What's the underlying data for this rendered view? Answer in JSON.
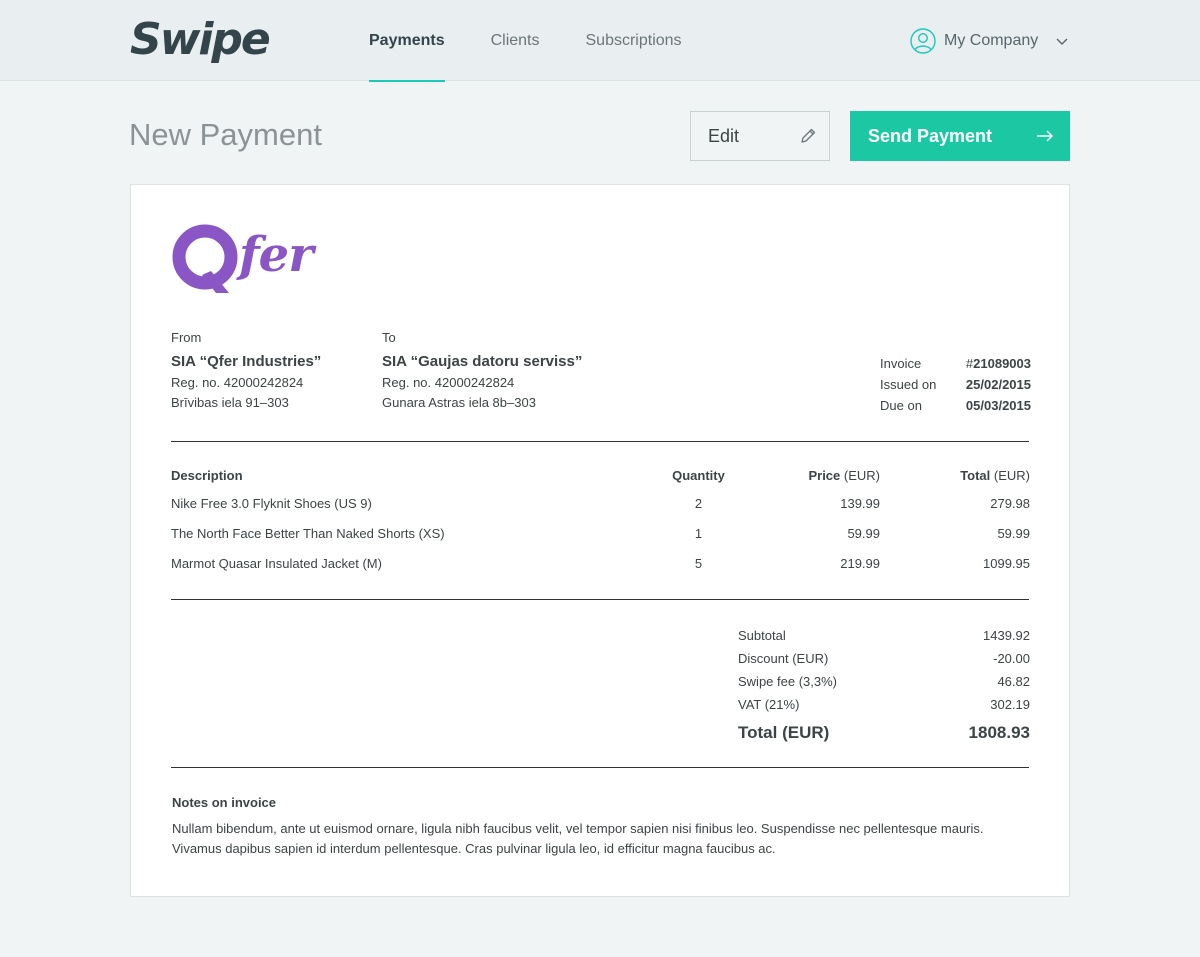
{
  "app": {
    "logo": "Swipe"
  },
  "nav": {
    "items": [
      {
        "label": "Payments",
        "active": true
      },
      {
        "label": "Clients",
        "active": false
      },
      {
        "label": "Subscriptions",
        "active": false
      }
    ]
  },
  "account": {
    "name": "My Company",
    "icon": "user-circle-icon",
    "chevron": "chevron-down-icon"
  },
  "page": {
    "title": "New Payment",
    "edit_label": "Edit",
    "edit_icon": "pencil-icon",
    "send_label": "Send Payment",
    "send_icon": "arrow-right-icon"
  },
  "colors": {
    "accent": "#1cc8b9",
    "send_button": "#1cc8a3",
    "brand_logo": "#8a56c6"
  },
  "invoice": {
    "brand": {
      "letter": "Q",
      "word": "fer"
    },
    "from": {
      "label": "From",
      "name": "SIA “Qfer Industries”",
      "reg": "Reg. no. 42000242824",
      "address": "Brīvibas iela 91–303"
    },
    "to": {
      "label": "To",
      "name": "SIA “Gaujas datoru serviss”",
      "reg": "Reg. no. 42000242824",
      "address": "Gunara Astras iela 8b–303"
    },
    "meta": {
      "invoice_label": "Invoice",
      "invoice_hash": "#",
      "invoice_number": "21089003",
      "issued_label": "Issued on",
      "issued_value": "25/02/2015",
      "due_label": "Due on",
      "due_value": "05/03/2015"
    },
    "table": {
      "headers": {
        "description": "Description",
        "quantity": "Quantity",
        "price": "Price",
        "price_unit": " (EUR)",
        "total": "Total",
        "total_unit": " (EUR)"
      },
      "rows": [
        {
          "description": "Nike Free 3.0 Flyknit Shoes (US 9)",
          "quantity": "2",
          "price": "139.99",
          "total": "279.98"
        },
        {
          "description": "The North Face Better Than Naked Shorts (XS)",
          "quantity": "1",
          "price": "59.99",
          "total": "59.99"
        },
        {
          "description": "Marmot Quasar Insulated Jacket (M)",
          "quantity": "5",
          "price": "219.99",
          "total": "1099.95"
        }
      ]
    },
    "totals": {
      "subtotal_label": "Subtotal",
      "subtotal_value": "1439.92",
      "discount_label": "Discount (EUR)",
      "discount_value": "-20.00",
      "fee_label": "Swipe fee (3,3%)",
      "fee_value": "46.82",
      "vat_label": "VAT (21%)",
      "vat_value": "302.19",
      "grand_label": "Total (EUR)",
      "grand_value": "1808.93"
    },
    "notes": {
      "heading": "Notes on invoice",
      "text": "Nullam bibendum, ante ut euismod ornare, ligula nibh faucibus velit, vel tempor sapien nisi finibus leo. Suspendisse nec pellentesque mauris. Vivamus dapibus sapien id interdum pellentesque. Cras pulvinar ligula leo, id efficitur magna faucibus ac."
    }
  }
}
